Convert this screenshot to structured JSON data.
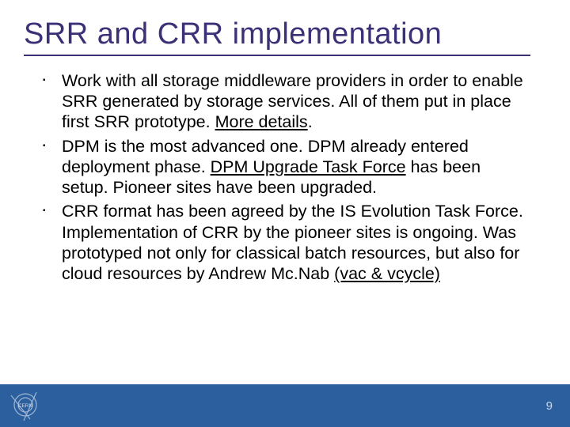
{
  "title": "SRR and CRR implementation",
  "bullets": [
    {
      "pre": "Work with all storage middleware providers in order to enable SRR generated by storage services. All of them put in place first SRR prototype. ",
      "link": "More details",
      "post": "."
    },
    {
      "pre": "DPM is the most advanced one. DPM already entered deployment phase. ",
      "link": "DPM Upgrade Task Force",
      "post": " has been setup. Pioneer sites have been upgraded."
    },
    {
      "pre": "CRR format has been agreed by the IS Evolution Task Force. Implementation of CRR by the pioneer sites is ongoing. Was prototyped not only for classical batch resources, but also for cloud resources  by Andrew Mc.Nab ",
      "link": "(vac & vcycle)",
      "post": ""
    }
  ],
  "page_number": "9",
  "logo_name": "CERN"
}
